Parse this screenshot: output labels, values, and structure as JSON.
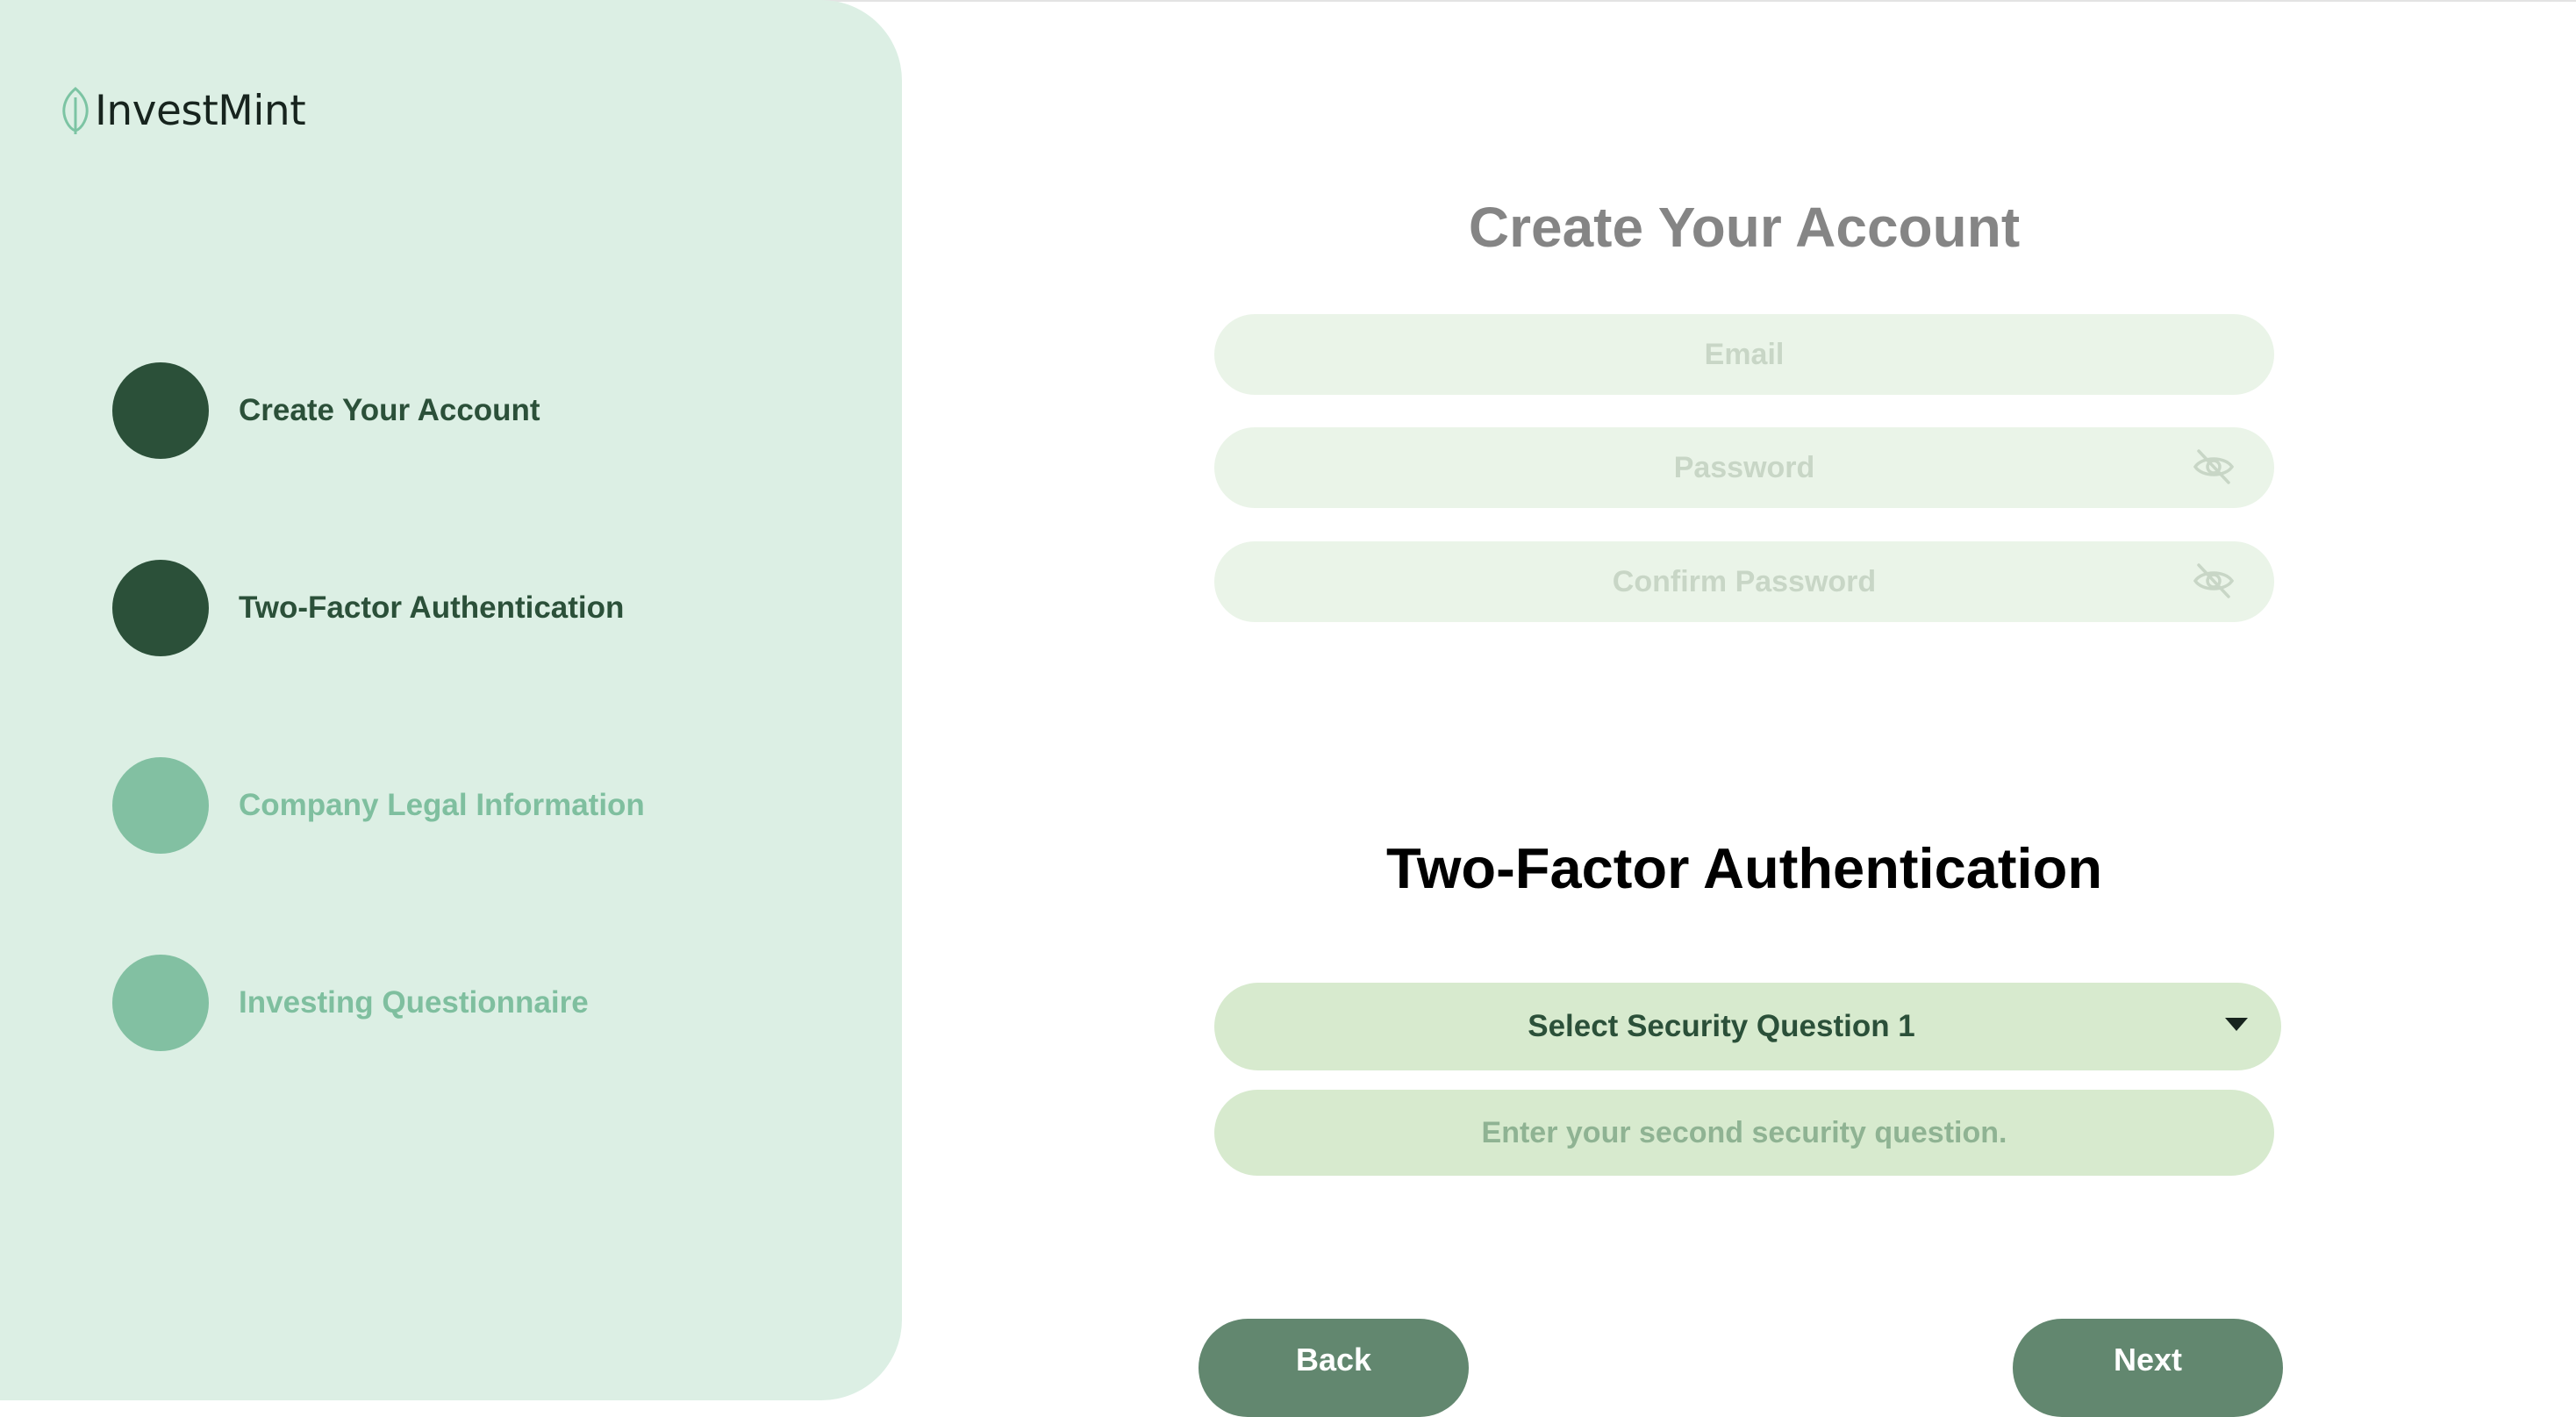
{
  "app": {
    "logo_text": "InvestMint"
  },
  "colors": {
    "sidebar_bg": "#dcefe4",
    "step_done": "#2b5039",
    "step_todo": "#82c0a2",
    "field_bg": "#eaf4e8",
    "security_bg": "#d7eace",
    "button_bg": "#62876f"
  },
  "sidebar": {
    "steps": [
      {
        "label": "Create Your Account",
        "state": "done"
      },
      {
        "label": "Two-Factor Authentication",
        "state": "done"
      },
      {
        "label": "Company Legal Information",
        "state": "todo"
      },
      {
        "label": "Investing Questionnaire",
        "state": "todo"
      }
    ]
  },
  "account": {
    "title": "Create Your Account",
    "email": {
      "placeholder": "Email",
      "value": ""
    },
    "password": {
      "placeholder": "Password",
      "value": "",
      "icon": "eye-off-icon"
    },
    "confirm_password": {
      "placeholder": "Confirm Password",
      "value": "",
      "icon": "eye-off-icon"
    }
  },
  "two_factor": {
    "title": "Two-Factor Authentication",
    "question1": {
      "selected": "Select Security Question 1",
      "icon": "caret-down-icon"
    },
    "question2": {
      "placeholder": "Enter your second security question.",
      "value": ""
    }
  },
  "nav": {
    "back_label": "Back",
    "next_label": "Next"
  }
}
